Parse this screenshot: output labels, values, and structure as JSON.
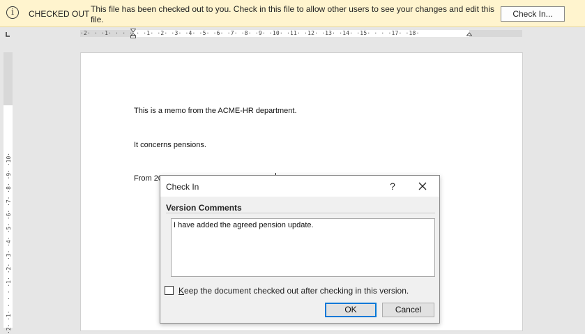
{
  "infobar": {
    "title": "CHECKED OUT",
    "message": "This file has been checked out to you. Check in this file to allow other users to see your changes and edit this file.",
    "checkin_button": "Check In...",
    "info_icon_glyph": "i",
    "background": "#fff4ce"
  },
  "ruler": {
    "horizontal_ticks": "·2· · ·1· · · · · ·1· ·2· ·3· ·4· ·5· ·6· ·7· ·8· ·9· ·10· ·11· ·12· ·13· ·14· ·15· · · ·17· ·18·",
    "vertical_ticks": "·2· ·1· · · · ·1· ·2· ·3· ·4· ·5· ·6· ·7· ·8· ·9· ·10·"
  },
  "document": {
    "paragraphs": [
      "This is a memo from the ACME-HR department.",
      "It concerns pensions.",
      "From 20"
    ]
  },
  "dialog": {
    "title": "Check In",
    "help_glyph": "?",
    "section_label": "Version Comments",
    "comment_value": "I have added the agreed pension update.",
    "keep_checked_out_prefix": "K",
    "keep_checked_out_rest": "eep the document checked out after checking in this version.",
    "keep_checked_out_checked": false,
    "ok_label": "OK",
    "cancel_label": "Cancel",
    "accent": "#0078d7"
  }
}
